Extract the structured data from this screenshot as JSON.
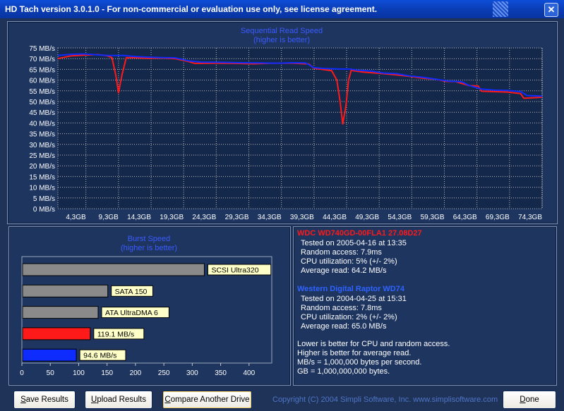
{
  "window": {
    "title": "HD Tach version 3.0.1.0  - For non-commercial or evaluation use only, see license agreement."
  },
  "colors": {
    "drive_a": "#ff1a1a",
    "drive_b": "#0f2cff",
    "bar_gray": "#8a8a8a",
    "label_bg": "#ffffc8",
    "window_bg": "#1f3358"
  },
  "chart_data": [
    {
      "type": "line",
      "title": "Sequential Read Speed",
      "subtitle": "(higher is better)",
      "yunit": "MB/s",
      "ylim": [
        0,
        75
      ],
      "yticks": [
        "0 MB/s",
        "5 MB/s",
        "10 MB/s",
        "15 MB/s",
        "20 MB/s",
        "25 MB/s",
        "30 MB/s",
        "35 MB/s",
        "40 MB/s",
        "45 MB/s",
        "50 MB/s",
        "55 MB/s",
        "60 MB/s",
        "65 MB/s",
        "70 MB/s",
        "75 MB/s"
      ],
      "xlim": [
        0,
        74.3
      ],
      "xticks": [
        {
          "value": 4.3,
          "label": "4,3GB"
        },
        {
          "value": 9.3,
          "label": "9,3GB"
        },
        {
          "value": 14.3,
          "label": "14,3GB"
        },
        {
          "value": 19.3,
          "label": "19,3GB"
        },
        {
          "value": 24.3,
          "label": "24,3GB"
        },
        {
          "value": 29.3,
          "label": "29,3GB"
        },
        {
          "value": 34.3,
          "label": "34,3GB"
        },
        {
          "value": 39.3,
          "label": "39,3GB"
        },
        {
          "value": 44.3,
          "label": "44,3GB"
        },
        {
          "value": 49.3,
          "label": "49,3GB"
        },
        {
          "value": 54.3,
          "label": "54,3GB"
        },
        {
          "value": 59.3,
          "label": "59,3GB"
        },
        {
          "value": 64.3,
          "label": "64,3GB"
        },
        {
          "value": 69.3,
          "label": "69,3GB"
        },
        {
          "value": 74.3,
          "label": "74,3GB"
        }
      ],
      "grid": true,
      "series": [
        {
          "name": "WDC WD740GD-00FLA1 27.08D27",
          "color": "#ff1a1a",
          "points": [
            [
              0,
              70.0
            ],
            [
              2,
              71.3
            ],
            [
              4,
              71.6
            ],
            [
              6,
              71.9
            ],
            [
              7.5,
              71.4
            ],
            [
              8.3,
              70.5
            ],
            [
              8.9,
              62
            ],
            [
              9.3,
              54
            ],
            [
              9.8,
              62
            ],
            [
              10.5,
              70.5
            ],
            [
              12,
              70.4
            ],
            [
              14,
              70.2
            ],
            [
              16,
              70.3
            ],
            [
              18,
              70.0
            ],
            [
              20,
              68.7
            ],
            [
              21,
              67.8
            ],
            [
              24,
              67.9
            ],
            [
              27,
              67.8
            ],
            [
              30,
              67.6
            ],
            [
              33,
              67.9
            ],
            [
              36,
              67.9
            ],
            [
              38.5,
              67.5
            ],
            [
              39.3,
              65.5
            ],
            [
              40.5,
              65.0
            ],
            [
              42,
              64.4
            ],
            [
              42.8,
              60
            ],
            [
              43.3,
              50
            ],
            [
              43.7,
              39.5
            ],
            [
              44.2,
              48
            ],
            [
              44.6,
              60
            ],
            [
              45,
              64.5
            ],
            [
              47,
              63.7
            ],
            [
              50,
              63.0
            ],
            [
              52,
              62.4
            ],
            [
              54,
              61.7
            ],
            [
              56,
              60.9
            ],
            [
              58,
              60.4
            ],
            [
              59.5,
              59.4
            ],
            [
              61,
              59.3
            ],
            [
              63,
              57.5
            ],
            [
              64.5,
              57.2
            ],
            [
              65,
              54.8
            ],
            [
              67,
              54.6
            ],
            [
              69,
              54.4
            ],
            [
              71,
              53.7
            ],
            [
              71.5,
              51.5
            ],
            [
              74.3,
              52.0
            ]
          ]
        },
        {
          "name": "Western Digital Raptor WD74",
          "color": "#0f2cff",
          "points": [
            [
              0,
              71.5
            ],
            [
              2,
              72.0
            ],
            [
              4,
              72.2
            ],
            [
              6,
              71.8
            ],
            [
              8,
              71.4
            ],
            [
              10,
              71.5
            ],
            [
              12,
              71.0
            ],
            [
              14,
              70.7
            ],
            [
              16,
              70.5
            ],
            [
              18,
              70.4
            ],
            [
              20,
              69.0
            ],
            [
              22,
              68.4
            ],
            [
              25,
              68.3
            ],
            [
              28,
              68.1
            ],
            [
              31,
              68.0
            ],
            [
              34,
              67.9
            ],
            [
              36,
              68.1
            ],
            [
              38,
              68.0
            ],
            [
              39.3,
              65.8
            ],
            [
              41,
              65.4
            ],
            [
              43,
              65.2
            ],
            [
              45,
              65.1
            ],
            [
              46,
              64.6
            ],
            [
              48,
              64.2
            ],
            [
              50,
              63.3
            ],
            [
              52,
              63.0
            ],
            [
              54,
              61.9
            ],
            [
              56,
              61.3
            ],
            [
              58,
              60.4
            ],
            [
              60,
              59.5
            ],
            [
              62,
              59.2
            ],
            [
              63,
              57.6
            ],
            [
              65,
              55.8
            ],
            [
              67,
              55.3
            ],
            [
              69,
              55.2
            ],
            [
              71,
              54.6
            ],
            [
              72,
              52.8
            ],
            [
              74.3,
              52.5
            ]
          ]
        }
      ]
    },
    {
      "type": "bar",
      "orientation": "horizontal",
      "title": "Burst Speed",
      "subtitle": "(higher is better)",
      "xlim": [
        0,
        440
      ],
      "xticks": [
        0,
        50,
        100,
        150,
        200,
        250,
        300,
        350,
        400
      ],
      "bars": [
        {
          "label": "SCSI Ultra320",
          "value": 320,
          "color": "#8a8a8a"
        },
        {
          "label": "SATA 150",
          "value": 150,
          "color": "#8a8a8a"
        },
        {
          "label": "ATA UltraDMA 6",
          "value": 133,
          "color": "#8a8a8a"
        },
        {
          "label": "119.1 MB/s",
          "value": 119.1,
          "color": "#ff1a1a"
        },
        {
          "label": "94.6 MB/s",
          "value": 94.6,
          "color": "#0f2cff"
        }
      ]
    }
  ],
  "info": {
    "drive_a": {
      "name": "WDC WD740GD-00FLA1 27.08D27",
      "tested": "Tested on 2005-04-16 at 13:35",
      "random_access": "Random access: 7.9ms",
      "cpu": "CPU utilization: 5% (+/- 2%)",
      "avg_read": "Average read: 64.2 MB/s"
    },
    "drive_b": {
      "name": "Western Digital Raptor WD74",
      "tested": "Tested on 2004-04-25 at 15:31",
      "random_access": "Random access: 7.8ms",
      "cpu": "CPU utilization: 2% (+/- 2%)",
      "avg_read": "Average read: 65.0 MB/s"
    },
    "notes": [
      "Lower is better for CPU and random access.",
      "Higher is better for average read.",
      "MB/s = 1,000,000 bytes per second.",
      "GB = 1,000,000,000 bytes."
    ]
  },
  "buttons": {
    "save": {
      "first": "S",
      "rest": "ave Results"
    },
    "upload": {
      "first": "U",
      "rest": "pload Results"
    },
    "compare": {
      "first": "C",
      "rest": "ompare Another Drive"
    },
    "done": {
      "first": "D",
      "rest": "one"
    }
  },
  "footer": {
    "copyright": "Copyright (C) 2004 Simpli Software, Inc. www.simplisoftware.com"
  }
}
